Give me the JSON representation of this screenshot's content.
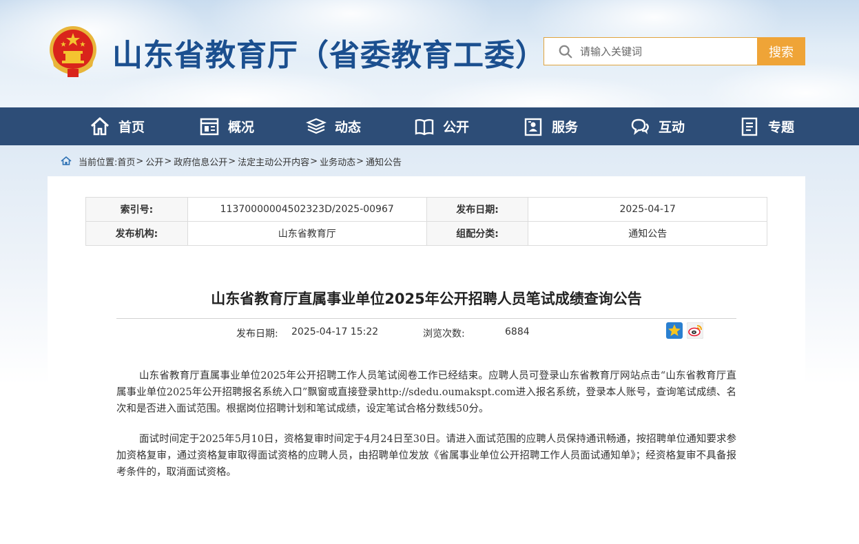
{
  "header": {
    "site_title": "山东省教育厅（省委教育工委）",
    "search_placeholder": "请输入关键词",
    "search_button": "搜索"
  },
  "nav": {
    "items": [
      {
        "label": "首页",
        "icon": "home-icon"
      },
      {
        "label": "概况",
        "icon": "overview-icon"
      },
      {
        "label": "动态",
        "icon": "news-stack-icon"
      },
      {
        "label": "公开",
        "icon": "open-book-icon"
      },
      {
        "label": "服务",
        "icon": "service-doc-icon"
      },
      {
        "label": "互动",
        "icon": "chat-bubbles-icon"
      },
      {
        "label": "专题",
        "icon": "topic-doc-icon"
      }
    ]
  },
  "breadcrumb": {
    "prefix": "当前位置:",
    "items": [
      "首页",
      "公开",
      "政府信息公开",
      "法定主动公开内容",
      "业务动态",
      "通知公告"
    ],
    "separator": ">"
  },
  "meta_table": {
    "index_label": "索引号:",
    "index_value": "11370000004502323D/2025-00967",
    "date_label": "发布日期:",
    "date_value": "2025-04-17",
    "org_label": "发布机构:",
    "org_value": "山东省教育厅",
    "category_label": "组配分类:",
    "category_value": "通知公告"
  },
  "article": {
    "title": "山东省教育厅直属事业单位2025年公开招聘人员笔试成绩查询公告",
    "publish_label": "发布日期:",
    "publish_value": "2025-04-17 15:22",
    "views_label": "浏览次数:",
    "views_value": "6884",
    "paragraphs": [
      "山东省教育厅直属事业单位2025年公开招聘工作人员笔试阅卷工作已经结束。应聘人员可登录山东省教育厅网站点击“山东省教育厅直属事业单位2025年公开招聘报名系统入口”飘窗或直接登录http://sdedu.oumakspt.com进入报名系统，登录本人账号，查询笔试成绩、名次和是否进入面试范围。根据岗位招聘计划和笔试成绩，设定笔试合格分数线50分。",
      "面试时间定于2025年5月10日，资格复审时间定于4月24日至30日。请进入面试范围的应聘人员保持通讯畅通，按招聘单位通知要求参加资格复审，通过资格复审取得面试资格的应聘人员，由招聘单位发放《省属事业单位公开招聘工作人员面试通知单》；经资格复审不具备报考条件的，取消面试资格。"
    ]
  },
  "colors": {
    "nav_bg": "#2d4d77",
    "title_blue": "#1b4f8f",
    "search_orange": "#efa437"
  }
}
